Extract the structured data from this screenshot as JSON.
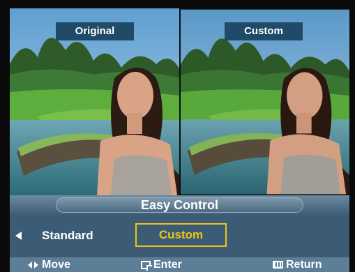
{
  "preview": {
    "left_label": "Original",
    "right_label": "Custom"
  },
  "menu": {
    "title": "Easy Control",
    "options": [
      "Standard",
      "Custom"
    ],
    "selected": "Custom",
    "highlight_color": "#f0c419"
  },
  "footer": {
    "move": "Move",
    "enter": "Enter",
    "return": "Return"
  },
  "icons": [
    "left-arrow-icon",
    "move-arrows-icon",
    "enter-icon",
    "return-icon"
  ]
}
